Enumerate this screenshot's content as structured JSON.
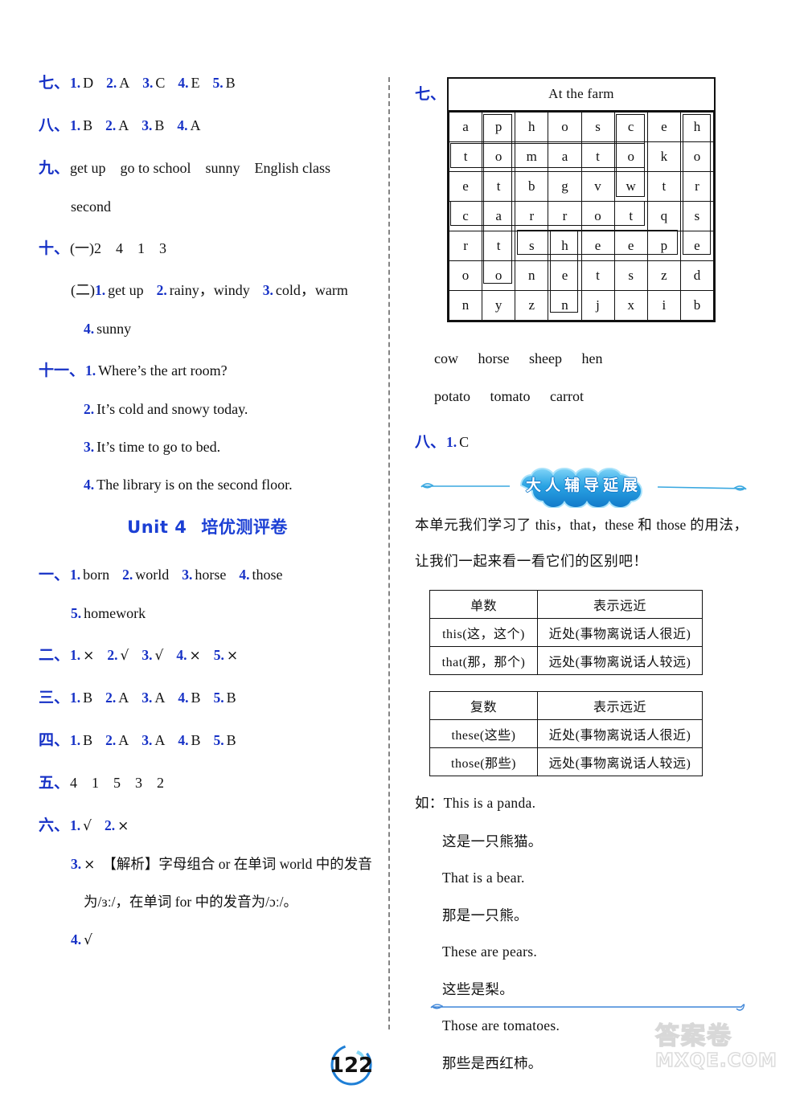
{
  "page": {
    "number": "122",
    "watermark_line1": "答案卷",
    "watermark_line2": "MXQE.COM"
  },
  "left_column": {
    "sections": [
      {
        "id": "sec-7",
        "cn_num": "七、",
        "items": [
          {
            "n": "1.",
            "v": "D"
          },
          {
            "n": "2.",
            "v": "A"
          },
          {
            "n": "3.",
            "v": "C"
          },
          {
            "n": "4.",
            "v": "E"
          },
          {
            "n": "5.",
            "v": "B"
          }
        ]
      },
      {
        "id": "sec-8",
        "cn_num": "八、",
        "items": [
          {
            "n": "1.",
            "v": "B"
          },
          {
            "n": "2.",
            "v": "A"
          },
          {
            "n": "3.",
            "v": "B"
          },
          {
            "n": "4.",
            "v": "A"
          }
        ]
      },
      {
        "id": "sec-9",
        "cn_num": "九、",
        "line1": "get up go to school sunny English class",
        "line2": "second"
      },
      {
        "id": "sec-10",
        "cn_num": "十、",
        "part1_label": "(一)",
        "part1_values": "2 4 1 3",
        "part2_label": "(二)",
        "part2_items": [
          {
            "n": "1.",
            "v": "get up"
          },
          {
            "n": "2.",
            "v": "rainy，windy"
          },
          {
            "n": "3.",
            "v": "cold，warm"
          }
        ],
        "part2_item4": {
          "n": "4.",
          "v": "sunny"
        }
      },
      {
        "id": "sec-11",
        "cn_num": "十一、",
        "items": [
          {
            "n": "1.",
            "v": "Where’s the art room?"
          },
          {
            "n": "2.",
            "v": "It’s cold and snowy today."
          },
          {
            "n": "3.",
            "v": "It’s time to go to bed."
          },
          {
            "n": "4.",
            "v": "The library is on the second floor."
          }
        ]
      }
    ],
    "unit_title": {
      "en": "Unit 4",
      "cn": "培优测评卷"
    },
    "unit4_sections": [
      {
        "id": "u4-sec-1",
        "cn_num": "一、",
        "items": [
          {
            "n": "1.",
            "v": "born"
          },
          {
            "n": "2.",
            "v": "world"
          },
          {
            "n": "3.",
            "v": "horse"
          },
          {
            "n": "4.",
            "v": "those"
          }
        ],
        "item5": {
          "n": "5.",
          "v": "homework"
        }
      },
      {
        "id": "u4-sec-2",
        "cn_num": "二、",
        "items": [
          {
            "n": "1.",
            "v": "×"
          },
          {
            "n": "2.",
            "v": "√"
          },
          {
            "n": "3.",
            "v": "√"
          },
          {
            "n": "4.",
            "v": "×"
          },
          {
            "n": "5.",
            "v": "×"
          }
        ]
      },
      {
        "id": "u4-sec-3",
        "cn_num": "三、",
        "items": [
          {
            "n": "1.",
            "v": "B"
          },
          {
            "n": "2.",
            "v": "A"
          },
          {
            "n": "3.",
            "v": "A"
          },
          {
            "n": "4.",
            "v": "B"
          },
          {
            "n": "5.",
            "v": "B"
          }
        ]
      },
      {
        "id": "u4-sec-4",
        "cn_num": "四、",
        "items": [
          {
            "n": "1.",
            "v": "B"
          },
          {
            "n": "2.",
            "v": "A"
          },
          {
            "n": "3.",
            "v": "A"
          },
          {
            "n": "4.",
            "v": "B"
          },
          {
            "n": "5.",
            "v": "B"
          }
        ]
      },
      {
        "id": "u4-sec-5",
        "cn_num": "五、",
        "sequence": "4 1 5 3 2"
      },
      {
        "id": "u4-sec-6",
        "cn_num": "六、",
        "items": [
          {
            "n": "1.",
            "v": "√"
          },
          {
            "n": "2.",
            "v": "×"
          }
        ],
        "item3": {
          "n": "3.",
          "v": "×"
        },
        "analysis_tag": "【解析】",
        "analysis_line1": "字母组合 or 在单词 world 中的发音",
        "analysis_line2": "为/ɜː/，在单词 for 中的发音为/ɔː/。",
        "item4": {
          "n": "4.",
          "v": "√"
        }
      }
    ]
  },
  "right_column": {
    "wordsearch": {
      "cn_num": "七、",
      "title": "At the farm",
      "grid": [
        [
          "a",
          "p",
          "h",
          "o",
          "s",
          "c",
          "e",
          "h"
        ],
        [
          "t",
          "o",
          "m",
          "a",
          "t",
          "o",
          "k",
          "o"
        ],
        [
          "e",
          "t",
          "b",
          "g",
          "v",
          "w",
          "t",
          "r"
        ],
        [
          "c",
          "a",
          "r",
          "r",
          "o",
          "t",
          "q",
          "s"
        ],
        [
          "r",
          "t",
          "s",
          "h",
          "e",
          "e",
          "p",
          "e"
        ],
        [
          "o",
          "o",
          "n",
          "e",
          "t",
          "s",
          "z",
          "d"
        ],
        [
          "n",
          "y",
          "z",
          "n",
          "j",
          "x",
          "i",
          "b"
        ]
      ],
      "highlights": [
        {
          "word": "potato",
          "dir": "vertical",
          "col": 1,
          "row": 0,
          "len": 6
        },
        {
          "word": "tomato",
          "dir": "horizontal",
          "col": 0,
          "row": 1,
          "len": 6
        },
        {
          "word": "cow",
          "dir": "vertical",
          "col": 5,
          "row": 0,
          "len": 3
        },
        {
          "word": "horse",
          "dir": "vertical",
          "col": 7,
          "row": 0,
          "len": 5
        },
        {
          "word": "carrot",
          "dir": "horizontal",
          "col": 0,
          "row": 3,
          "len": 6
        },
        {
          "word": "sheep",
          "dir": "horizontal",
          "col": 2,
          "row": 4,
          "len": 5
        },
        {
          "word": "hen",
          "dir": "vertical",
          "col": 3,
          "row": 4,
          "len": 3
        }
      ],
      "answer_row1": [
        "cow",
        "horse",
        "sheep",
        "hen"
      ],
      "answer_row2": [
        "potato",
        "tomato",
        "carrot"
      ]
    },
    "sec8": {
      "cn_num": "八、",
      "n": "1.",
      "v": "C"
    },
    "banner": {
      "text": "大人辅导延展",
      "color": "#1b8fd4"
    },
    "intro_line1_pre": "本单元我们学习了 ",
    "intro_line1_en": "this，that，these",
    "intro_line1_mid": " 和 ",
    "intro_line1_en2": "those",
    "intro_line1_post": " 的用法，",
    "intro_line2": "让我们一起来看一看它们的区别吧！",
    "table_singular": {
      "header": [
        "单数",
        "表示远近"
      ],
      "rows": [
        [
          "this(这，这个)",
          "近处(事物离说话人很近)"
        ],
        [
          "that(那，那个)",
          "远处(事物离说话人较远)"
        ]
      ]
    },
    "table_plural": {
      "header": [
        "复数",
        "表示远近"
      ],
      "rows": [
        [
          "these(这些)",
          "近处(事物离说话人很近)"
        ],
        [
          "those(那些)",
          "远处(事物离说话人较远)"
        ]
      ]
    },
    "examples": [
      {
        "label": "如：",
        "text": "This is a panda.",
        "indent": false
      },
      {
        "label": "",
        "text": "这是一只熊猫。",
        "indent": true
      },
      {
        "label": "",
        "text": "That is a bear.",
        "indent": true
      },
      {
        "label": "",
        "text": "那是一只熊。",
        "indent": true
      },
      {
        "label": "",
        "text": "These are pears.",
        "indent": true
      },
      {
        "label": "",
        "text": "这些是梨。",
        "indent": true
      },
      {
        "label": "",
        "text": "Those are tomatoes.",
        "indent": true
      },
      {
        "label": "",
        "text": "那些是西红柿。",
        "indent": true
      }
    ]
  }
}
